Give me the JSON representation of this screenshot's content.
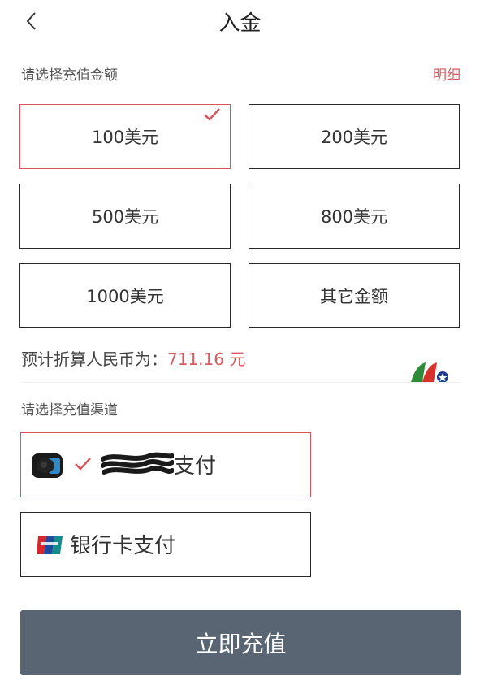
{
  "header": {
    "title": "入金"
  },
  "amount_section": {
    "label": "请选择充值金额",
    "detail_link": "明细"
  },
  "amounts": [
    {
      "label": "100美元",
      "selected": true
    },
    {
      "label": "200美元",
      "selected": false
    },
    {
      "label": "500美元",
      "selected": false
    },
    {
      "label": "800美元",
      "selected": false
    },
    {
      "label": "1000美元",
      "selected": false
    },
    {
      "label": "其它金额",
      "selected": false
    }
  ],
  "estimate": {
    "prefix": "预计折算人民币为：",
    "value": "711.16 元"
  },
  "channel_section": {
    "label": "请选择充值渠道"
  },
  "channels": [
    {
      "label": "支付",
      "icon": "wallet-icon",
      "selected": true
    },
    {
      "label": "银行卡支付",
      "icon": "unionpay-icon",
      "selected": false
    }
  ],
  "submit": {
    "label": "立即充值"
  },
  "colors": {
    "accent": "#d9535c",
    "button": "#5a6573"
  }
}
